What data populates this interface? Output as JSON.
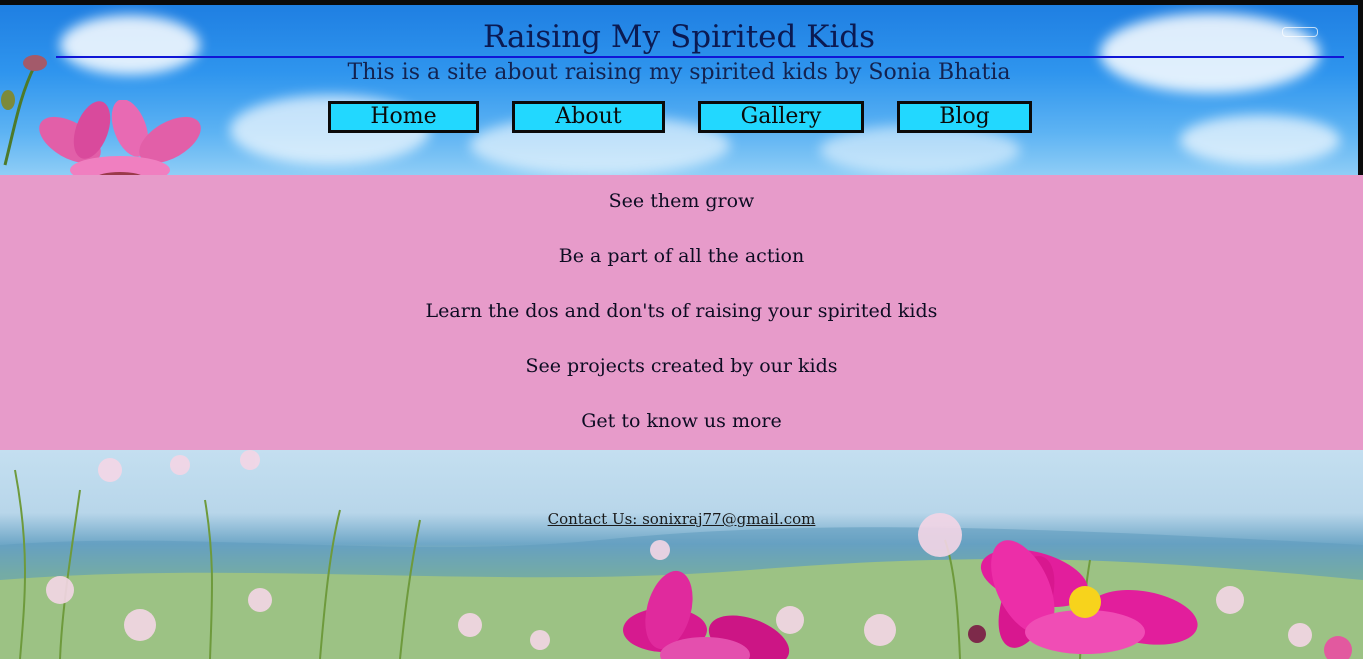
{
  "header": {
    "title": "Raising My Spirited Kids",
    "subtitle": "This is a site about raising my spirited kids by Sonia Bhatia"
  },
  "nav": {
    "items": [
      {
        "label": "Home"
      },
      {
        "label": "About"
      },
      {
        "label": "Gallery"
      },
      {
        "label": "Blog"
      }
    ],
    "button_color": "#22d8ff"
  },
  "features": {
    "background": "#e79bca",
    "lines": [
      "See them grow",
      "Be a part of all the action",
      "Learn the dos and don'ts of raising your spirited kids",
      "See projects created by our kids",
      "Get to know us more"
    ]
  },
  "footer": {
    "contact": "Contact Us: sonixraj77@gmail.com"
  }
}
